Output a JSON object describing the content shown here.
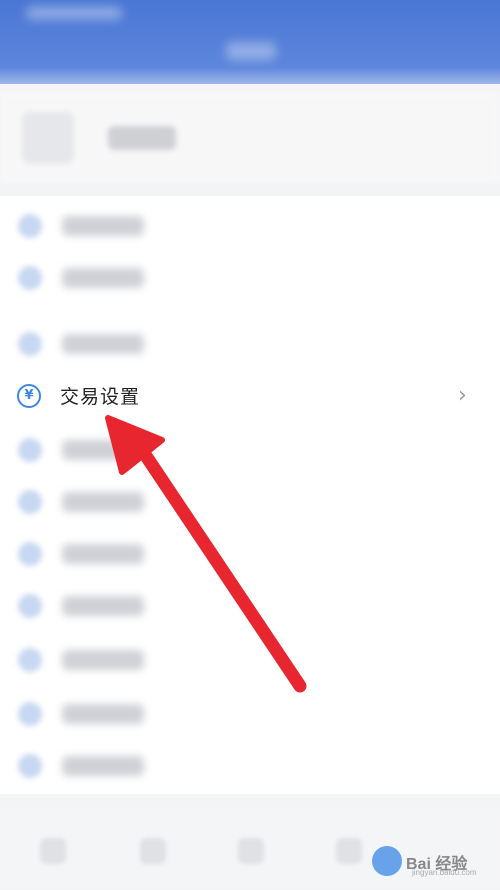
{
  "menu": {
    "item_label": "交易设置",
    "item_icon": "yen-icon",
    "icon_glyph": "¥",
    "chevron_glyph": "›"
  },
  "watermark": {
    "brand": "Bai 经验",
    "sub": "jingyan.baidu.com"
  },
  "colors": {
    "header": "#4a76d4",
    "accent": "#3d86e3",
    "arrow": "#e8262f"
  }
}
